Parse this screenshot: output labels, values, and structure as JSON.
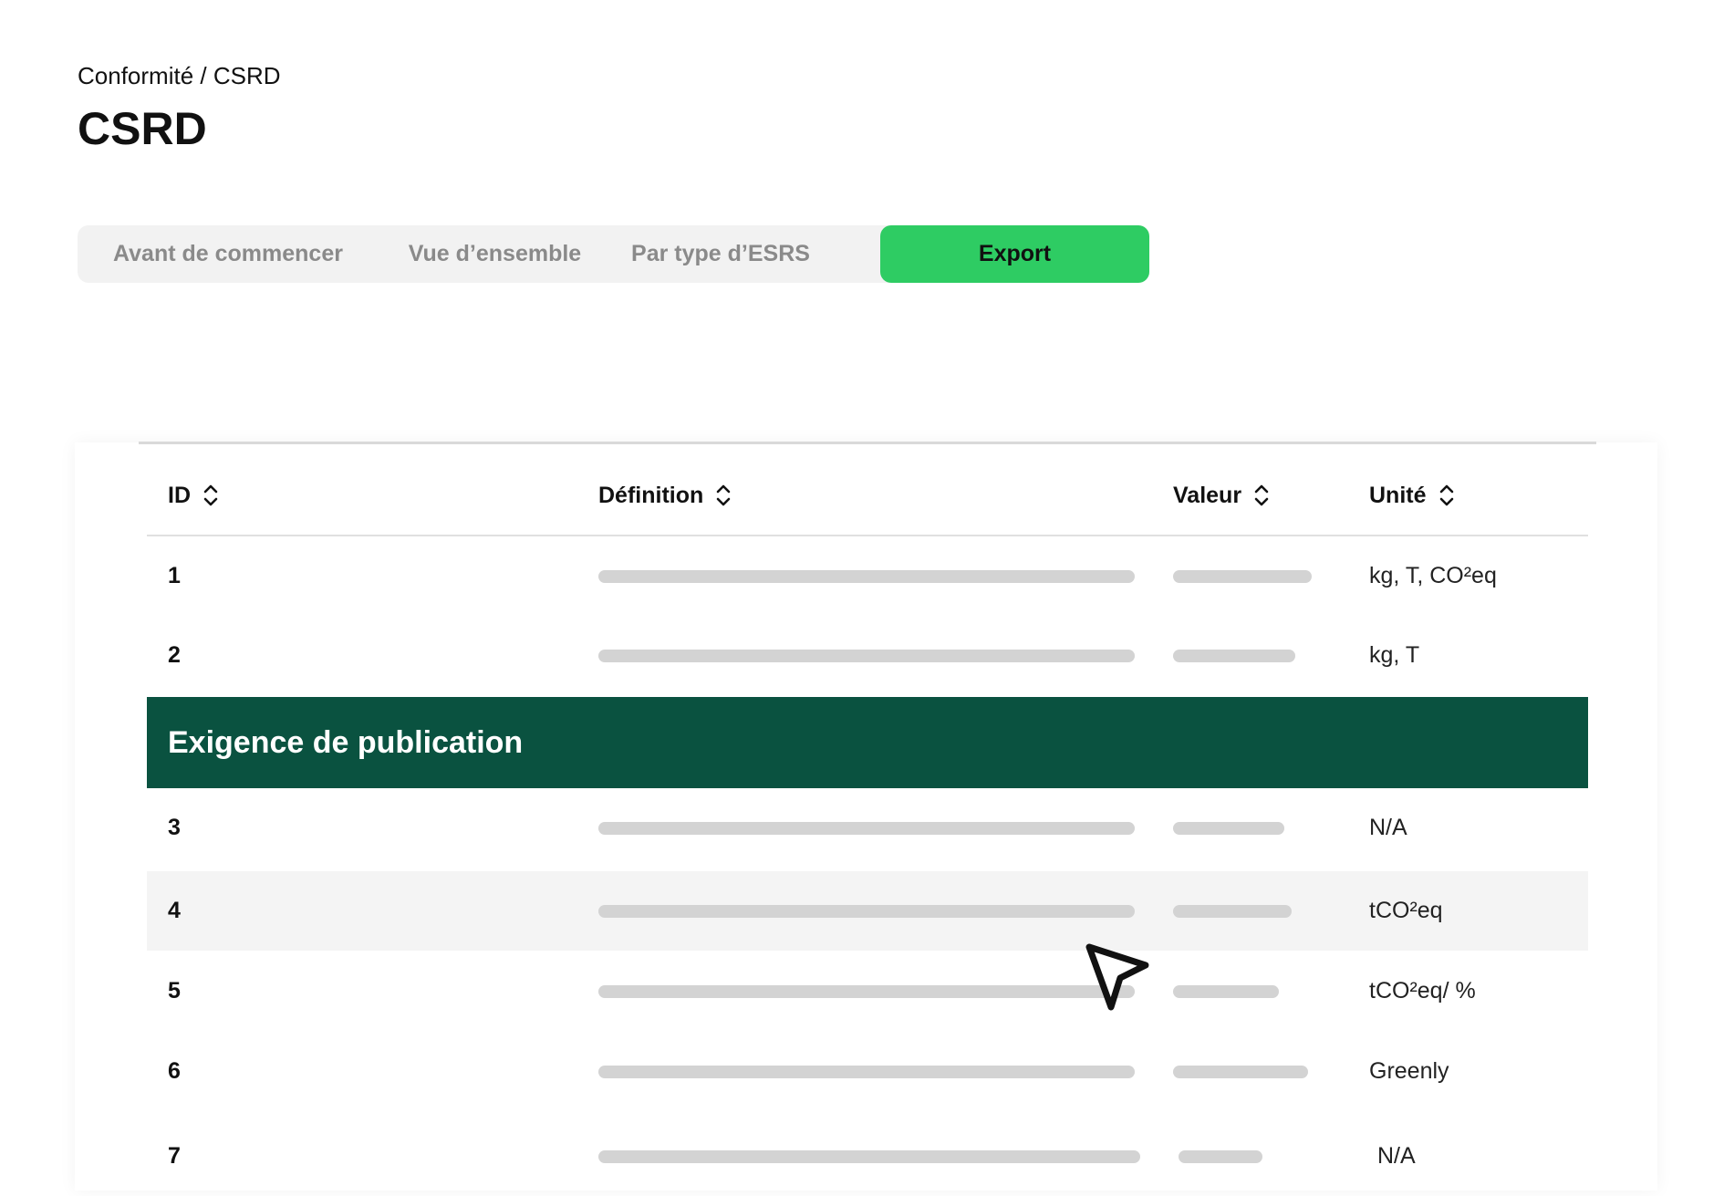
{
  "breadcrumb": "Conformité / CSRD",
  "title": "CSRD",
  "tabs": [
    {
      "label": "Avant de commencer"
    },
    {
      "label": "Vue d’ensemble"
    },
    {
      "label": "Par type d’ESRS"
    },
    {
      "label": "Export"
    }
  ],
  "active_tab": "Export",
  "colors": {
    "accent": "#2ecc63",
    "section": "#0a5240",
    "placeholder": "#d3d3d3"
  },
  "table": {
    "columns": [
      {
        "label": "ID",
        "icon": "sort-icon"
      },
      {
        "label": "Définition",
        "icon": "sort-icon"
      },
      {
        "label": "Valeur",
        "icon": "sort-icon"
      },
      {
        "label": "Unité",
        "icon": "sort-icon"
      }
    ],
    "rows_top": [
      {
        "id": "1",
        "unit": "kg, T, CO²eq"
      },
      {
        "id": "2",
        "unit": "kg, T"
      }
    ],
    "section_label": "Exigence de publication",
    "rows_bottom": [
      {
        "id": "3",
        "unit": "N/A"
      },
      {
        "id": "4",
        "unit": "tCO²eq"
      },
      {
        "id": "5",
        "unit": "tCO²eq/ %"
      },
      {
        "id": "6",
        "unit": "Greenly"
      },
      {
        "id": "7",
        "unit": "N/A"
      }
    ]
  },
  "cursor_icon": "pointer-cursor-icon"
}
